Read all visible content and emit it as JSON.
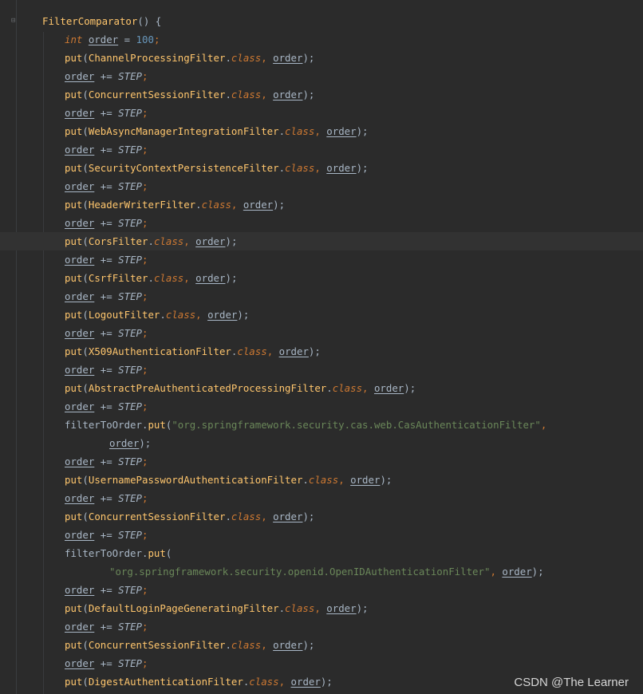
{
  "editor": {
    "lines": [
      {
        "indent": 0,
        "tokens": [
          {
            "t": "FilterComparator",
            "c": "mth"
          },
          {
            "t": "() {",
            "c": "plain"
          }
        ]
      },
      {
        "indent": 1,
        "tokens": [
          {
            "t": "int ",
            "c": "kw italic"
          },
          {
            "t": "order",
            "c": "var"
          },
          {
            "t": " = ",
            "c": "plain"
          },
          {
            "t": "100",
            "c": "num"
          },
          {
            "t": ";",
            "c": "kw"
          }
        ]
      },
      {
        "indent": 1,
        "tokens": [
          {
            "t": "put",
            "c": "call"
          },
          {
            "t": "(",
            "c": "plain"
          },
          {
            "t": "ChannelProcessingFilter",
            "c": "cls"
          },
          {
            "t": ".",
            "c": "plain"
          },
          {
            "t": "class",
            "c": "keyclass"
          },
          {
            "t": ", ",
            "c": "kw"
          },
          {
            "t": "order",
            "c": "var"
          },
          {
            "t": ");",
            "c": "plain"
          }
        ]
      },
      {
        "indent": 1,
        "tokens": [
          {
            "t": "order",
            "c": "var"
          },
          {
            "t": " += ",
            "c": "plain"
          },
          {
            "t": "STEP",
            "c": "constf"
          },
          {
            "t": ";",
            "c": "kw"
          }
        ]
      },
      {
        "indent": 1,
        "tokens": [
          {
            "t": "put",
            "c": "call"
          },
          {
            "t": "(",
            "c": "plain"
          },
          {
            "t": "ConcurrentSessionFilter",
            "c": "cls"
          },
          {
            "t": ".",
            "c": "plain"
          },
          {
            "t": "class",
            "c": "keyclass"
          },
          {
            "t": ", ",
            "c": "kw"
          },
          {
            "t": "order",
            "c": "var"
          },
          {
            "t": ");",
            "c": "plain"
          }
        ]
      },
      {
        "indent": 1,
        "tokens": [
          {
            "t": "order",
            "c": "var"
          },
          {
            "t": " += ",
            "c": "plain"
          },
          {
            "t": "STEP",
            "c": "constf"
          },
          {
            "t": ";",
            "c": "kw"
          }
        ]
      },
      {
        "indent": 1,
        "tokens": [
          {
            "t": "put",
            "c": "call"
          },
          {
            "t": "(",
            "c": "plain"
          },
          {
            "t": "WebAsyncManagerIntegrationFilter",
            "c": "cls"
          },
          {
            "t": ".",
            "c": "plain"
          },
          {
            "t": "class",
            "c": "keyclass"
          },
          {
            "t": ", ",
            "c": "kw"
          },
          {
            "t": "order",
            "c": "var"
          },
          {
            "t": ");",
            "c": "plain"
          }
        ]
      },
      {
        "indent": 1,
        "tokens": [
          {
            "t": "order",
            "c": "var"
          },
          {
            "t": " += ",
            "c": "plain"
          },
          {
            "t": "STEP",
            "c": "constf"
          },
          {
            "t": ";",
            "c": "kw"
          }
        ]
      },
      {
        "indent": 1,
        "tokens": [
          {
            "t": "put",
            "c": "call"
          },
          {
            "t": "(",
            "c": "plain"
          },
          {
            "t": "SecurityContextPersistenceFilter",
            "c": "cls"
          },
          {
            "t": ".",
            "c": "plain"
          },
          {
            "t": "class",
            "c": "keyclass"
          },
          {
            "t": ", ",
            "c": "kw"
          },
          {
            "t": "order",
            "c": "var"
          },
          {
            "t": ");",
            "c": "plain"
          }
        ]
      },
      {
        "indent": 1,
        "tokens": [
          {
            "t": "order",
            "c": "var"
          },
          {
            "t": " += ",
            "c": "plain"
          },
          {
            "t": "STEP",
            "c": "constf"
          },
          {
            "t": ";",
            "c": "kw"
          }
        ]
      },
      {
        "indent": 1,
        "tokens": [
          {
            "t": "put",
            "c": "call"
          },
          {
            "t": "(",
            "c": "plain"
          },
          {
            "t": "HeaderWriterFilter",
            "c": "cls"
          },
          {
            "t": ".",
            "c": "plain"
          },
          {
            "t": "class",
            "c": "keyclass"
          },
          {
            "t": ", ",
            "c": "kw"
          },
          {
            "t": "order",
            "c": "var"
          },
          {
            "t": ");",
            "c": "plain"
          }
        ]
      },
      {
        "indent": 1,
        "tokens": [
          {
            "t": "order",
            "c": "var"
          },
          {
            "t": " += ",
            "c": "plain"
          },
          {
            "t": "STEP",
            "c": "constf"
          },
          {
            "t": ";",
            "c": "kw"
          }
        ]
      },
      {
        "indent": 1,
        "current": true,
        "tokens": [
          {
            "t": "put",
            "c": "call"
          },
          {
            "t": "(",
            "c": "plain"
          },
          {
            "t": "CorsFilter",
            "c": "cls"
          },
          {
            "t": ".",
            "c": "plain"
          },
          {
            "t": "class",
            "c": "keyclass"
          },
          {
            "t": ", ",
            "c": "kw"
          },
          {
            "t": "order",
            "c": "var"
          },
          {
            "t": ");",
            "c": "plain"
          }
        ]
      },
      {
        "indent": 1,
        "tokens": [
          {
            "t": "order",
            "c": "var"
          },
          {
            "t": " += ",
            "c": "plain"
          },
          {
            "t": "STEP",
            "c": "constf"
          },
          {
            "t": ";",
            "c": "kw"
          }
        ]
      },
      {
        "indent": 1,
        "tokens": [
          {
            "t": "put",
            "c": "call"
          },
          {
            "t": "(",
            "c": "plain"
          },
          {
            "t": "CsrfFilter",
            "c": "cls"
          },
          {
            "t": ".",
            "c": "plain"
          },
          {
            "t": "class",
            "c": "keyclass"
          },
          {
            "t": ", ",
            "c": "kw"
          },
          {
            "t": "order",
            "c": "var"
          },
          {
            "t": ");",
            "c": "plain"
          }
        ]
      },
      {
        "indent": 1,
        "tokens": [
          {
            "t": "order",
            "c": "var"
          },
          {
            "t": " += ",
            "c": "plain"
          },
          {
            "t": "STEP",
            "c": "constf"
          },
          {
            "t": ";",
            "c": "kw"
          }
        ]
      },
      {
        "indent": 1,
        "tokens": [
          {
            "t": "put",
            "c": "call"
          },
          {
            "t": "(",
            "c": "plain"
          },
          {
            "t": "LogoutFilter",
            "c": "cls"
          },
          {
            "t": ".",
            "c": "plain"
          },
          {
            "t": "class",
            "c": "keyclass"
          },
          {
            "t": ", ",
            "c": "kw"
          },
          {
            "t": "order",
            "c": "var"
          },
          {
            "t": ");",
            "c": "plain"
          }
        ]
      },
      {
        "indent": 1,
        "tokens": [
          {
            "t": "order",
            "c": "var"
          },
          {
            "t": " += ",
            "c": "plain"
          },
          {
            "t": "STEP",
            "c": "constf"
          },
          {
            "t": ";",
            "c": "kw"
          }
        ]
      },
      {
        "indent": 1,
        "tokens": [
          {
            "t": "put",
            "c": "call"
          },
          {
            "t": "(",
            "c": "plain"
          },
          {
            "t": "X509AuthenticationFilter",
            "c": "cls"
          },
          {
            "t": ".",
            "c": "plain"
          },
          {
            "t": "class",
            "c": "keyclass"
          },
          {
            "t": ", ",
            "c": "kw"
          },
          {
            "t": "order",
            "c": "var"
          },
          {
            "t": ");",
            "c": "plain"
          }
        ]
      },
      {
        "indent": 1,
        "tokens": [
          {
            "t": "order",
            "c": "var"
          },
          {
            "t": " += ",
            "c": "plain"
          },
          {
            "t": "STEP",
            "c": "constf"
          },
          {
            "t": ";",
            "c": "kw"
          }
        ]
      },
      {
        "indent": 1,
        "tokens": [
          {
            "t": "put",
            "c": "call"
          },
          {
            "t": "(",
            "c": "plain"
          },
          {
            "t": "AbstractPreAuthenticatedProcessingFilter",
            "c": "cls"
          },
          {
            "t": ".",
            "c": "plain"
          },
          {
            "t": "class",
            "c": "keyclass"
          },
          {
            "t": ", ",
            "c": "kw"
          },
          {
            "t": "order",
            "c": "var"
          },
          {
            "t": ");",
            "c": "plain"
          }
        ]
      },
      {
        "indent": 1,
        "tokens": [
          {
            "t": "order",
            "c": "var"
          },
          {
            "t": " += ",
            "c": "plain"
          },
          {
            "t": "STEP",
            "c": "constf"
          },
          {
            "t": ";",
            "c": "kw"
          }
        ]
      },
      {
        "indent": 1,
        "tokens": [
          {
            "t": "filterToOrder",
            "c": "plain"
          },
          {
            "t": ".",
            "c": "plain"
          },
          {
            "t": "put",
            "c": "call"
          },
          {
            "t": "(",
            "c": "plain"
          },
          {
            "t": "\"org.springframework.security.cas.web.CasAuthenticationFilter\"",
            "c": "str"
          },
          {
            "t": ",",
            "c": "kw"
          }
        ]
      },
      {
        "indent": 3,
        "tokens": [
          {
            "t": "order",
            "c": "var"
          },
          {
            "t": ");",
            "c": "plain"
          }
        ]
      },
      {
        "indent": 1,
        "tokens": [
          {
            "t": "order",
            "c": "var"
          },
          {
            "t": " += ",
            "c": "plain"
          },
          {
            "t": "STEP",
            "c": "constf"
          },
          {
            "t": ";",
            "c": "kw"
          }
        ]
      },
      {
        "indent": 1,
        "tokens": [
          {
            "t": "put",
            "c": "call"
          },
          {
            "t": "(",
            "c": "plain"
          },
          {
            "t": "UsernamePasswordAuthenticationFilter",
            "c": "cls"
          },
          {
            "t": ".",
            "c": "plain"
          },
          {
            "t": "class",
            "c": "keyclass"
          },
          {
            "t": ", ",
            "c": "kw"
          },
          {
            "t": "order",
            "c": "var"
          },
          {
            "t": ");",
            "c": "plain"
          }
        ]
      },
      {
        "indent": 1,
        "tokens": [
          {
            "t": "order",
            "c": "var"
          },
          {
            "t": " += ",
            "c": "plain"
          },
          {
            "t": "STEP",
            "c": "constf"
          },
          {
            "t": ";",
            "c": "kw"
          }
        ]
      },
      {
        "indent": 1,
        "tokens": [
          {
            "t": "put",
            "c": "call"
          },
          {
            "t": "(",
            "c": "plain"
          },
          {
            "t": "ConcurrentSessionFilter",
            "c": "cls"
          },
          {
            "t": ".",
            "c": "plain"
          },
          {
            "t": "class",
            "c": "keyclass"
          },
          {
            "t": ", ",
            "c": "kw"
          },
          {
            "t": "order",
            "c": "var"
          },
          {
            "t": ");",
            "c": "plain"
          }
        ]
      },
      {
        "indent": 1,
        "tokens": [
          {
            "t": "order",
            "c": "var"
          },
          {
            "t": " += ",
            "c": "plain"
          },
          {
            "t": "STEP",
            "c": "constf"
          },
          {
            "t": ";",
            "c": "kw"
          }
        ]
      },
      {
        "indent": 1,
        "tokens": [
          {
            "t": "filterToOrder",
            "c": "plain"
          },
          {
            "t": ".",
            "c": "plain"
          },
          {
            "t": "put",
            "c": "call"
          },
          {
            "t": "(",
            "c": "plain"
          }
        ]
      },
      {
        "indent": 3,
        "tokens": [
          {
            "t": "\"org.springframework.security.openid.OpenIDAuthenticationFilter\"",
            "c": "str"
          },
          {
            "t": ", ",
            "c": "kw"
          },
          {
            "t": "order",
            "c": "var"
          },
          {
            "t": ");",
            "c": "plain"
          }
        ]
      },
      {
        "indent": 1,
        "tokens": [
          {
            "t": "order",
            "c": "var"
          },
          {
            "t": " += ",
            "c": "plain"
          },
          {
            "t": "STEP",
            "c": "constf"
          },
          {
            "t": ";",
            "c": "kw"
          }
        ]
      },
      {
        "indent": 1,
        "tokens": [
          {
            "t": "put",
            "c": "call"
          },
          {
            "t": "(",
            "c": "plain"
          },
          {
            "t": "DefaultLoginPageGeneratingFilter",
            "c": "cls"
          },
          {
            "t": ".",
            "c": "plain"
          },
          {
            "t": "class",
            "c": "keyclass"
          },
          {
            "t": ", ",
            "c": "kw"
          },
          {
            "t": "order",
            "c": "var"
          },
          {
            "t": ");",
            "c": "plain"
          }
        ]
      },
      {
        "indent": 1,
        "tokens": [
          {
            "t": "order",
            "c": "var"
          },
          {
            "t": " += ",
            "c": "plain"
          },
          {
            "t": "STEP",
            "c": "constf"
          },
          {
            "t": ";",
            "c": "kw"
          }
        ]
      },
      {
        "indent": 1,
        "tokens": [
          {
            "t": "put",
            "c": "call"
          },
          {
            "t": "(",
            "c": "plain"
          },
          {
            "t": "ConcurrentSessionFilter",
            "c": "cls"
          },
          {
            "t": ".",
            "c": "plain"
          },
          {
            "t": "class",
            "c": "keyclass"
          },
          {
            "t": ", ",
            "c": "kw"
          },
          {
            "t": "order",
            "c": "var"
          },
          {
            "t": ");",
            "c": "plain"
          }
        ]
      },
      {
        "indent": 1,
        "tokens": [
          {
            "t": "order",
            "c": "var"
          },
          {
            "t": " += ",
            "c": "plain"
          },
          {
            "t": "STEP",
            "c": "constf"
          },
          {
            "t": ";",
            "c": "kw"
          }
        ]
      },
      {
        "indent": 1,
        "tokens": [
          {
            "t": "put",
            "c": "call"
          },
          {
            "t": "(",
            "c": "plain"
          },
          {
            "t": "DigestAuthenticationFilter",
            "c": "cls"
          },
          {
            "t": ".",
            "c": "plain"
          },
          {
            "t": "class",
            "c": "keyclass"
          },
          {
            "t": ", ",
            "c": "kw"
          },
          {
            "t": "order",
            "c": "var"
          },
          {
            "t": ");",
            "c": "plain"
          }
        ]
      }
    ]
  },
  "watermark": "CSDN @The Learner",
  "colors": {
    "background": "#2b2b2b",
    "current_line": "#323232",
    "keyword": "#cc7832",
    "number": "#6897bb",
    "method": "#ffc66d",
    "string": "#6a8759",
    "text": "#a9b7c6"
  },
  "icons": {
    "fold": "fold-collapse-icon"
  }
}
